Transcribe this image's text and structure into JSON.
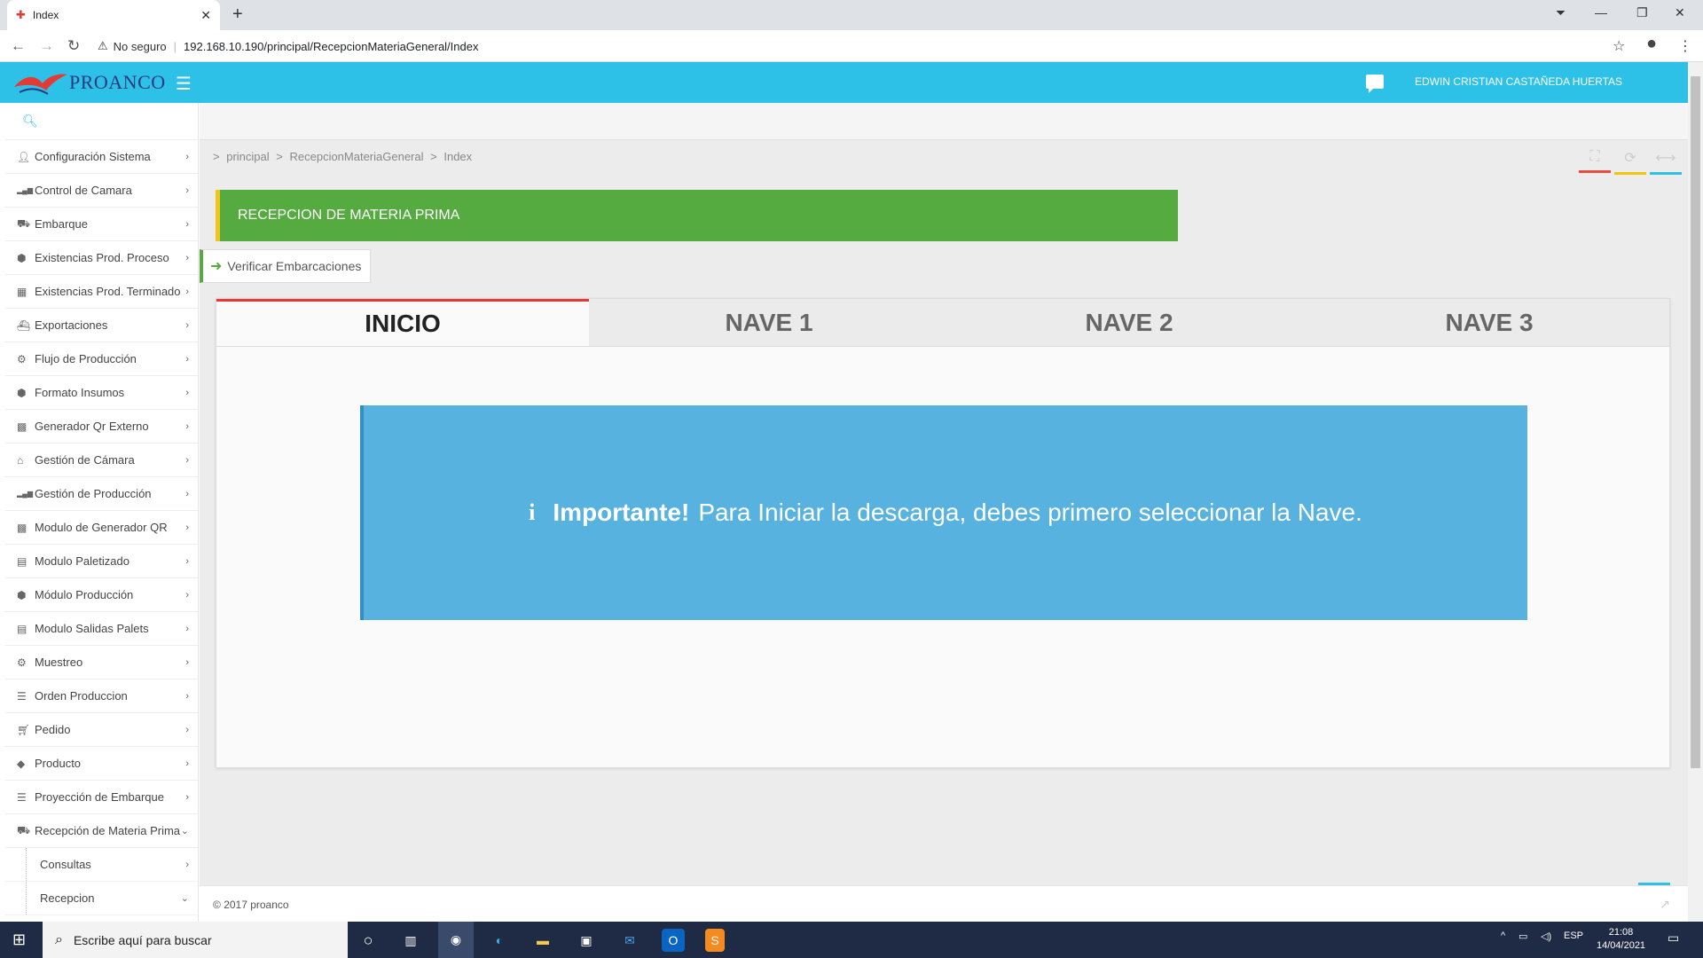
{
  "browser": {
    "tab_title": "Index",
    "security_label": "No seguro",
    "url": "192.168.10.190/principal/RecepcionMateriaGeneral/Index"
  },
  "header": {
    "logo_text": "PROANCO",
    "user_name": "EDWIN CRISTIAN CASTAÑEDA HUERTAS"
  },
  "sidebar": {
    "items": [
      {
        "label": "Configuración Sistema",
        "icon": "user-icon"
      },
      {
        "label": "Control de Camara",
        "icon": "bar-chart-icon"
      },
      {
        "label": "Embarque",
        "icon": "truck-icon"
      },
      {
        "label": "Existencias Prod. Proceso",
        "icon": "cubes-icon"
      },
      {
        "label": "Existencias Prod. Terminado",
        "icon": "building-icon"
      },
      {
        "label": "Exportaciones",
        "icon": "ship-icon"
      },
      {
        "label": "Flujo de Producción",
        "icon": "cogs-icon"
      },
      {
        "label": "Formato Insumos",
        "icon": "cubes-icon"
      },
      {
        "label": "Generador Qr Externo",
        "icon": "qrcode-icon"
      },
      {
        "label": "Gestión de Cámara",
        "icon": "bank-icon"
      },
      {
        "label": "Gestión de Producción",
        "icon": "bar-chart-icon"
      },
      {
        "label": "Modulo de Generador QR",
        "icon": "qrcode-icon"
      },
      {
        "label": "Modulo Paletizado",
        "icon": "calendar-icon"
      },
      {
        "label": "Módulo Producción",
        "icon": "cubes-icon"
      },
      {
        "label": "Modulo Salidas Palets",
        "icon": "calendar-icon"
      },
      {
        "label": "Muestreo",
        "icon": "cogs-icon"
      },
      {
        "label": "Orden Produccion",
        "icon": "sliders-icon"
      },
      {
        "label": "Pedido",
        "icon": "cart-icon"
      },
      {
        "label": "Producto",
        "icon": "cube-icon"
      },
      {
        "label": "Proyección de Embarque",
        "icon": "sliders-icon"
      },
      {
        "label": "Recepción de Materia Prima",
        "icon": "truck-icon"
      }
    ],
    "subitems": [
      {
        "label": "Consultas"
      },
      {
        "label": "Recepcion"
      }
    ]
  },
  "breadcrumb": {
    "items": [
      "principal",
      ">",
      "RecepcionMateriaGeneral",
      ">",
      "Index"
    ]
  },
  "page": {
    "title": "RECEPCION DE MATERIA PRIMA",
    "verify_button": "Verificar Embarcaciones",
    "tabs": [
      "INICIO",
      "NAVE 1",
      "NAVE 2",
      "NAVE 3"
    ],
    "alert_strong": "Importante!",
    "alert_text": "Para Iniciar la descarga, debes primero seleccionar la Nave."
  },
  "footer": {
    "copyright": "2017 proanco"
  },
  "taskbar": {
    "search_placeholder": "Escribe aquí para buscar",
    "lang": "ESP",
    "time": "21:08",
    "date": "14/04/2021"
  },
  "colors": {
    "header": "#2ec1e8",
    "title_bar": "#55ab40",
    "alert": "#57b2e0",
    "active_tab_border": "#e53935"
  }
}
